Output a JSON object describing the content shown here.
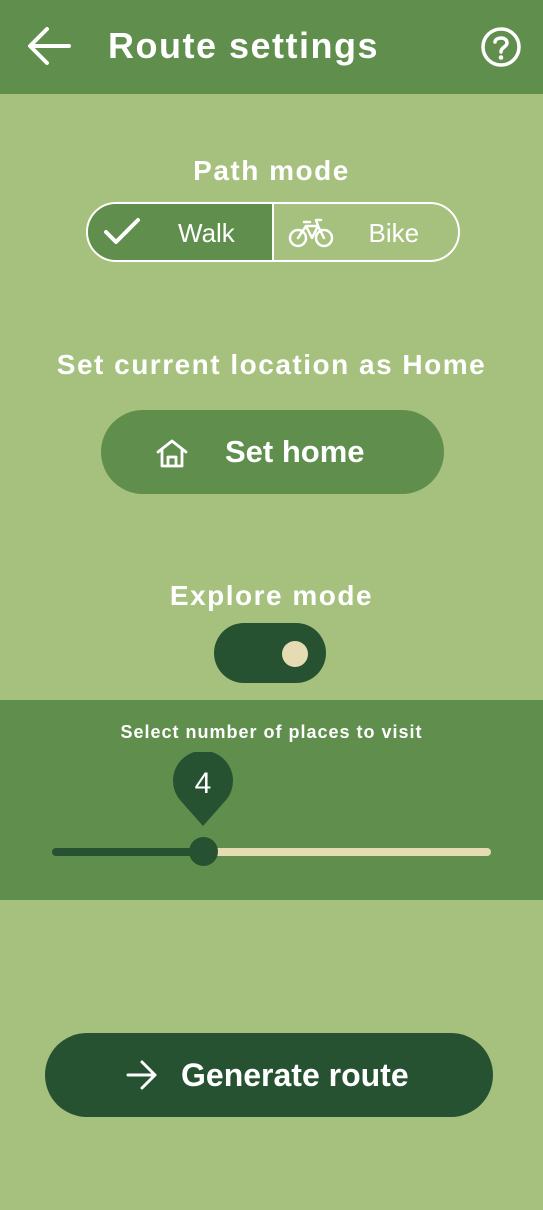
{
  "header": {
    "title": "Route settings",
    "back_icon": "arrow-left-icon",
    "help_icon": "help-circle-icon"
  },
  "path_mode": {
    "label": "Path mode",
    "options": [
      {
        "label": "Walk",
        "icon": "check-icon",
        "selected": true
      },
      {
        "label": "Bike",
        "icon": "bicycle-icon",
        "selected": false
      }
    ]
  },
  "home": {
    "label": "Set current location as Home",
    "button_label": "Set home",
    "icon": "home-icon"
  },
  "explore": {
    "label": "Explore mode",
    "enabled": true
  },
  "places": {
    "label": "Select number of places to visit",
    "value": "4"
  },
  "generate": {
    "button_label": "Generate route",
    "icon": "arrow-right-icon"
  },
  "colors": {
    "background": "#a6c07d",
    "primary": "#5f8e4d",
    "dark": "#265232",
    "accent": "#e6dcb3",
    "text": "#ffffff"
  }
}
